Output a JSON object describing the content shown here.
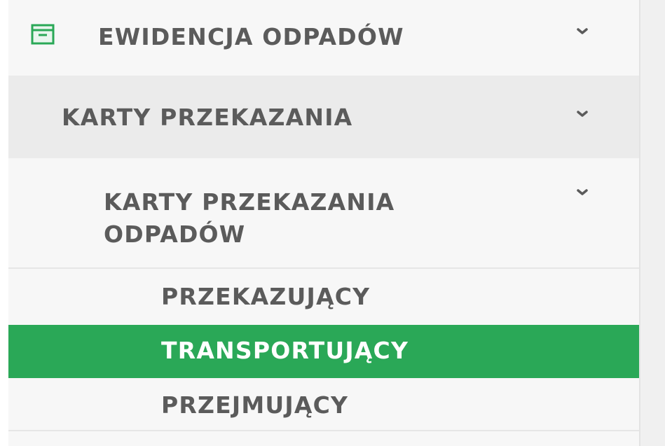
{
  "sidebar": {
    "items": [
      {
        "label": "EWIDENCJA ODPADÓW",
        "icon": "archive-icon",
        "expanded": true
      },
      {
        "label": "KARTY PRZEKAZANIA",
        "expanded": true
      },
      {
        "label": "KARTY PRZEKAZANIA ODPADÓW",
        "expanded": true
      },
      {
        "label": "PRZEKAZUJĄCY"
      },
      {
        "label": "TRANSPORTUJĄCY",
        "active": true
      },
      {
        "label": "PRZEJMUJĄCY"
      }
    ]
  },
  "colors": {
    "active_bg": "#2aa857",
    "text": "#5b5b5b",
    "icon_green": "#2aa857"
  }
}
